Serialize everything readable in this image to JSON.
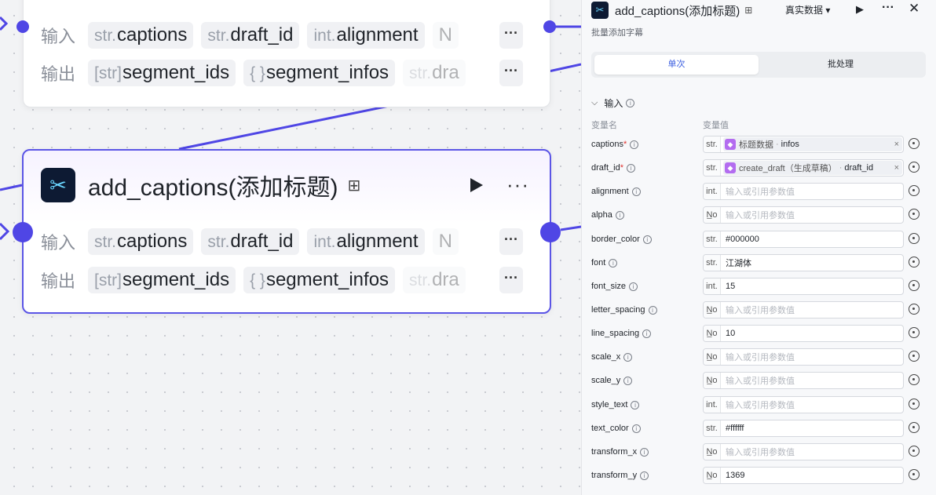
{
  "nodes": {
    "top": {
      "inputs_label": "输入",
      "outputs_label": "输出",
      "inputs": [
        {
          "type": "str.",
          "name": "captions"
        },
        {
          "type": "str.",
          "name": "draft_id"
        },
        {
          "type": "int.",
          "name": "alignment"
        },
        {
          "type": "",
          "name": "N"
        }
      ],
      "outputs": [
        {
          "type": "[str]",
          "name": "segment_ids"
        },
        {
          "type": "{ }",
          "name": "segment_infos"
        },
        {
          "type": "str.",
          "name": "dra"
        }
      ],
      "more": "···"
    },
    "main": {
      "title": "add_captions(添加标题)",
      "more": "···",
      "inputs_label": "输入",
      "outputs_label": "输出",
      "inputs": [
        {
          "type": "str.",
          "name": "captions"
        },
        {
          "type": "str.",
          "name": "draft_id"
        },
        {
          "type": "int.",
          "name": "alignment"
        },
        {
          "type": "",
          "name": "N"
        }
      ],
      "outputs": [
        {
          "type": "[str]",
          "name": "segment_ids"
        },
        {
          "type": "{ }",
          "name": "segment_infos"
        },
        {
          "type": "str.",
          "name": "dra"
        }
      ]
    }
  },
  "panel": {
    "title": "add_captions(添加标题)",
    "data_select": "真实数据 ▾",
    "description": "批量添加字幕",
    "tabs": [
      {
        "label": "单次",
        "active": true
      },
      {
        "label": "批处理",
        "active": false
      }
    ],
    "section_title": "输入",
    "col_name": "变量名",
    "col_value": "变量值",
    "params": [
      {
        "name": "captions",
        "required": true,
        "type": "str.",
        "ref": {
          "node": "标题数据",
          "field": "infos"
        }
      },
      {
        "name": "draft_id",
        "required": true,
        "type": "str.",
        "ref": {
          "node": "create_draft（生成草稿）",
          "field": "draft_id"
        }
      },
      {
        "name": "alignment",
        "type": "int.",
        "placeholder": "输入或引用参数值"
      },
      {
        "name": "alpha",
        "type": "N̲o",
        "placeholder": "输入或引用参数值"
      },
      {
        "name": "border_color",
        "type": "str.",
        "value": "#000000"
      },
      {
        "name": "font",
        "type": "str.",
        "value": "江湖体"
      },
      {
        "name": "font_size",
        "type": "int.",
        "value": "15"
      },
      {
        "name": "letter_spacing",
        "type": "N̲o",
        "placeholder": "输入或引用参数值"
      },
      {
        "name": "line_spacing",
        "type": "N̲o",
        "value": "10"
      },
      {
        "name": "scale_x",
        "type": "N̲o",
        "placeholder": "输入或引用参数值"
      },
      {
        "name": "scale_y",
        "type": "N̲o",
        "placeholder": "输入或引用参数值"
      },
      {
        "name": "style_text",
        "type": "int.",
        "placeholder": "输入或引用参数值"
      },
      {
        "name": "text_color",
        "type": "str.",
        "value": "#ffffff"
      },
      {
        "name": "transform_x",
        "type": "N̲o",
        "placeholder": "输入或引用参数值"
      },
      {
        "name": "transform_y",
        "type": "N̲o",
        "value": "1369"
      }
    ]
  },
  "colors": {
    "accent": "#4f46e5",
    "ref_icon": "#b36cf0",
    "required": "#e0322f"
  }
}
